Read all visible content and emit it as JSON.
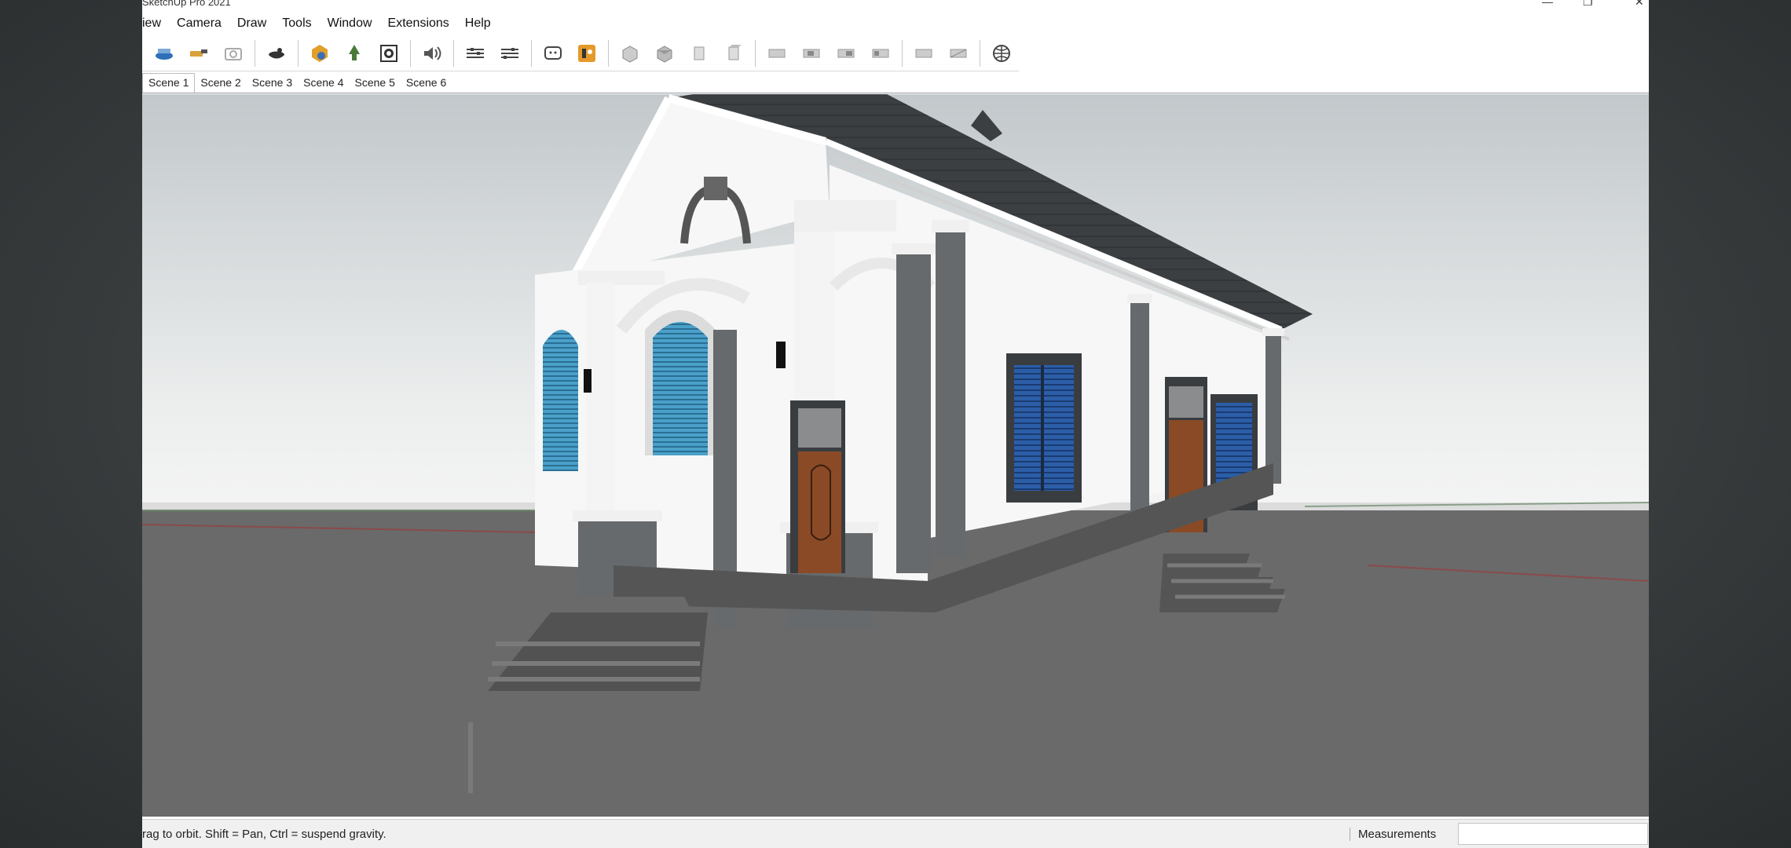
{
  "app": {
    "title": "SketchUp Pro 2021"
  },
  "menu": [
    "iew",
    "Camera",
    "Draw",
    "Tools",
    "Window",
    "Extensions",
    "Help"
  ],
  "toolbar": {
    "icons": [
      "section-plane-icon",
      "walk-icon",
      "camera-icon",
      "orbit-icon",
      "warehouse-icon",
      "components-icon",
      "materials-icon",
      "sound-icon",
      "layers-icon",
      "styles-icon",
      "chat-icon",
      "profile-icon",
      "view-iso-icon",
      "view-top-icon",
      "view-front-icon",
      "view-right-icon",
      "view-back-icon",
      "view-left-icon",
      "view-bottom-icon",
      "view-perspective-icon",
      "view-parallel-icon",
      "view-two-point-icon",
      "geo-location-icon"
    ]
  },
  "scenes": [
    "Scene 1",
    "Scene 2",
    "Scene 3",
    "Scene 4",
    "Scene 5",
    "Scene 6"
  ],
  "active_scene": "Scene 1",
  "status": {
    "hint": "rag to orbit. Shift = Pan, Ctrl = suspend gravity.",
    "measurements_label": "Measurements",
    "measurements_value": ""
  },
  "colors": {
    "sky_top": "#c2c8cb",
    "sky_bottom": "#f4f4f4",
    "ground": "#6a6a6a",
    "roof": "#3c3f42",
    "wall": "#f7f7f7",
    "pillar": "#676a6c",
    "glass": "#3a8ab0",
    "door": "#8a4a26"
  }
}
